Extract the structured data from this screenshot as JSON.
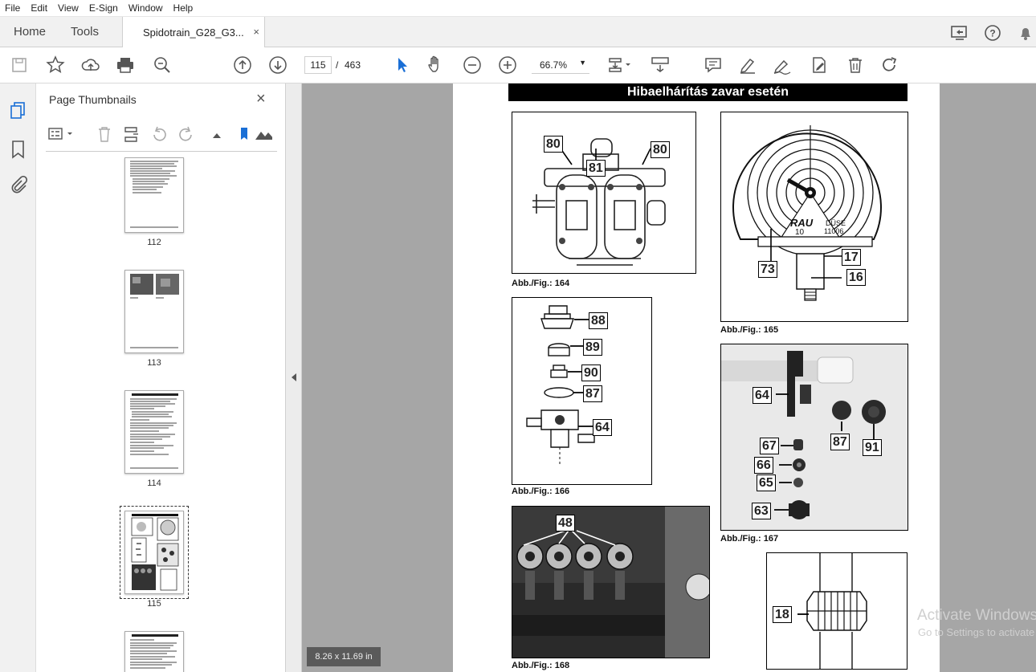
{
  "menu": [
    "File",
    "Edit",
    "View",
    "E-Sign",
    "Window",
    "Help"
  ],
  "tabs": {
    "home": "Home",
    "tools": "Tools",
    "document": "Spidotrain_G28_G3...",
    "close": "×"
  },
  "toolbar": {
    "current_page": "115",
    "page_separator": "/",
    "total_pages": "463",
    "zoom": "66.7%"
  },
  "panel": {
    "title": "Page Thumbnails",
    "close": "×"
  },
  "thumbnails": [
    {
      "label": "112"
    },
    {
      "label": "113"
    },
    {
      "label": "114"
    },
    {
      "label": "115"
    }
  ],
  "page": {
    "header": "Hibaelhárítás zavar esetén",
    "figures": {
      "f164": {
        "caption": "Abb./Fig.: 164",
        "labels": [
          "80",
          "81",
          "80"
        ]
      },
      "f165": {
        "caption": "Abb./Fig.: 165",
        "labels": [
          "73",
          "17",
          "16"
        ],
        "dial": [
          "RAU",
          "10",
          "DÜSE",
          "11006"
        ]
      },
      "f166": {
        "caption": "Abb./Fig.: 166",
        "labels": [
          "88",
          "89",
          "90",
          "87",
          "64"
        ]
      },
      "f167": {
        "caption": "Abb./Fig.: 167",
        "labels": [
          "64",
          "87",
          "91",
          "67",
          "66",
          "65",
          "63"
        ]
      },
      "f168": {
        "caption": "Abb./Fig.: 168",
        "labels": [
          "48"
        ]
      },
      "f169": {
        "labels": [
          "18"
        ]
      }
    }
  },
  "status": {
    "page_size": "8.26 x 11.69 in"
  },
  "watermark": {
    "line1": "Activate Windows",
    "line2": "Go to Settings to activate Windows."
  }
}
